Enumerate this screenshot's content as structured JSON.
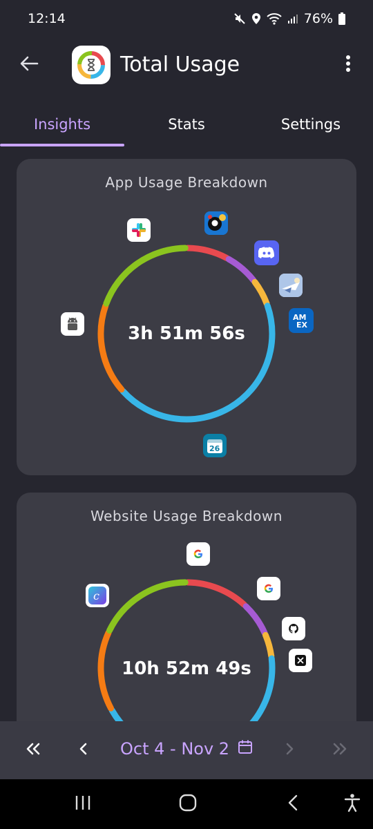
{
  "status_bar": {
    "time": "12:14",
    "battery": "76%",
    "icons": [
      "mute-icon",
      "location-icon",
      "wifi-icon",
      "signal-icon",
      "battery-icon"
    ]
  },
  "app_bar": {
    "title": "Total Usage",
    "back_icon": "arrow-left-icon",
    "more_icon": "more-vertical-icon"
  },
  "tabs": [
    {
      "label": "Insights",
      "active": true
    },
    {
      "label": "Stats",
      "active": false
    },
    {
      "label": "Settings",
      "active": false
    }
  ],
  "app_usage": {
    "title": "App Usage Breakdown",
    "total": "3h 51m 56s",
    "segments": [
      {
        "color": "#e84a4f",
        "fraction": 0.08
      },
      {
        "color": "#a65bd4",
        "fraction": 0.065
      },
      {
        "color": "#f6b73c",
        "fraction": 0.05
      },
      {
        "color": "#38b6e8",
        "fraction": 0.44
      },
      {
        "color": "#f57c14",
        "fraction": 0.17
      },
      {
        "color": "#8bc41f",
        "fraction": 0.195
      }
    ],
    "apps": [
      "slack-icon",
      "8-ball-pool-icon",
      "discord-icon",
      "game-icon",
      "amex-icon",
      "calendar-icon",
      "android-icon"
    ],
    "calendar_day": "26"
  },
  "website_usage": {
    "title": "Website Usage Breakdown",
    "total": "10h 52m 49s",
    "segments": [
      {
        "color": "#e84a4f",
        "fraction": 0.12
      },
      {
        "color": "#a65bd4",
        "fraction": 0.065
      },
      {
        "color": "#f6b73c",
        "fraction": 0.045
      },
      {
        "color": "#38b6e8",
        "fraction": 0.44
      },
      {
        "color": "#f57c14",
        "fraction": 0.15
      },
      {
        "color": "#8bc41f",
        "fraction": 0.18
      }
    ],
    "sites": [
      "google-icon",
      "google-icon",
      "canva-icon",
      "github-icon",
      "x-icon"
    ]
  },
  "date_bar": {
    "range": "Oct 4 - Nov 2",
    "icons": [
      "double-chevron-left-icon",
      "chevron-left-icon",
      "calendar-icon",
      "chevron-right-icon",
      "double-chevron-right-icon"
    ]
  },
  "colors": {
    "accent": "#c9a4ff",
    "background": "#26262f",
    "card": "#3c3c45"
  }
}
